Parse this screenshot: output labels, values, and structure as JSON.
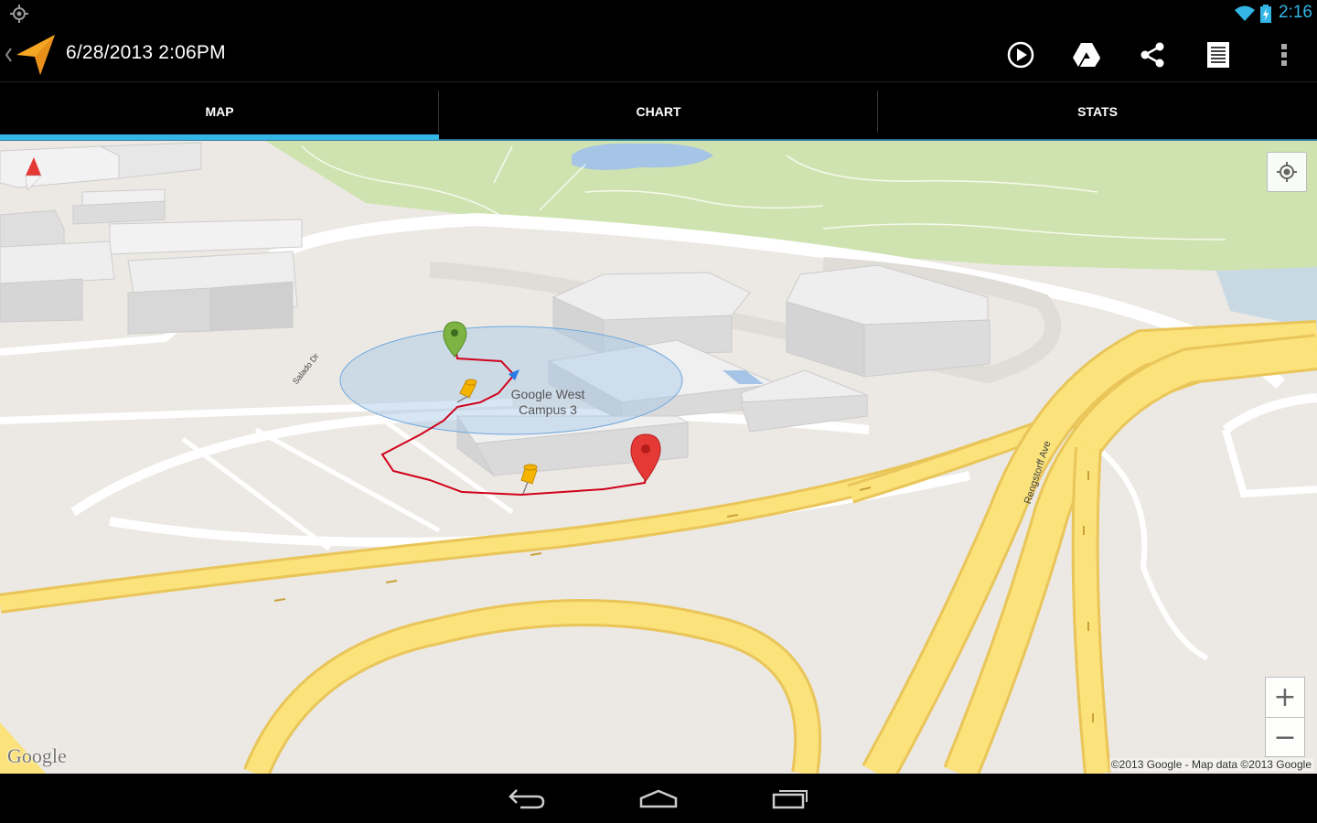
{
  "status_bar": {
    "time": "2:16",
    "icons": [
      "gps-icon",
      "wifi-icon",
      "battery-charging-icon"
    ]
  },
  "action_bar": {
    "title": "6/28/2013 2:06PM",
    "app_icon": "navigation-arrow-icon",
    "actions": [
      "play-icon",
      "drive-icon",
      "share-icon",
      "list-icon",
      "overflow-icon"
    ]
  },
  "tabs": [
    {
      "label": "MAP",
      "selected": true
    },
    {
      "label": "CHART",
      "selected": false
    },
    {
      "label": "STATS",
      "selected": false
    }
  ],
  "map": {
    "place_label": "Google West\nCampus 3",
    "street_labels": [
      "Rengstorff Ave",
      "Salado Dr"
    ],
    "logo": "Google",
    "attribution": "©2013 Google - Map data ©2013 Google",
    "zoom_in": "+",
    "zoom_out": "−",
    "colors": {
      "accent": "#33b5e5",
      "track": "#d0021b",
      "start_marker": "#7cb342",
      "end_marker": "#e53935",
      "waypoint": "#f5b400",
      "highway": "#fbe27a",
      "park": "#cfe3b0",
      "water": "#a6c4e6"
    }
  },
  "nav_bar": {
    "buttons": [
      "back-icon",
      "home-icon",
      "recent-apps-icon"
    ]
  }
}
